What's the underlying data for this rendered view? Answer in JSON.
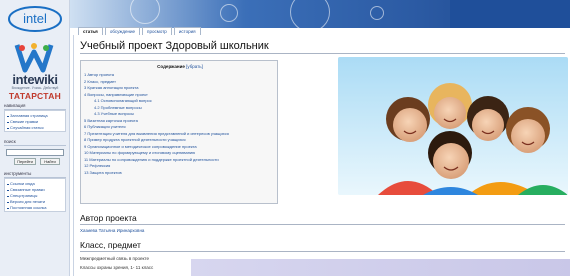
{
  "sidebar": {
    "logo_text": "intel",
    "brand": "intewiki",
    "tagline": "Вхождение. Учись. Действуй",
    "region": "ТАТАРСТАН",
    "navigation": {
      "heading": "навигация",
      "items": [
        "Заглавная страница",
        "Свежие правки",
        "Случайная статья"
      ]
    },
    "search": {
      "heading": "поиск",
      "go_label": "Перейти",
      "find_label": "Найти",
      "value": ""
    },
    "toolbox": {
      "heading": "инструменты",
      "items": [
        "Ссылки сюда",
        "Связанные правки",
        "Спецстраницы",
        "Версия для печати",
        "Постоянная ссылка"
      ]
    }
  },
  "tabs": [
    {
      "label": "статья",
      "active": true
    },
    {
      "label": "обсуждение",
      "active": false
    },
    {
      "label": "просмотр",
      "active": false
    },
    {
      "label": "история",
      "active": false
    }
  ],
  "page": {
    "title": "Учебный проект Здоровый школьник"
  },
  "toc": {
    "title": "Содержание",
    "toggle": "[убрать]",
    "items": [
      {
        "text": "1 Автор проекта",
        "level": 1
      },
      {
        "text": "2 Класс, предмет",
        "level": 1
      },
      {
        "text": "3 Краткая аннотация проекта",
        "level": 1
      },
      {
        "text": "4 Вопросы, направляющие проект",
        "level": 1
      },
      {
        "text": "4.1 Основополагающий вопрос",
        "level": 2
      },
      {
        "text": "4.2 Проблемные вопросы",
        "level": 2
      },
      {
        "text": "4.3 Учебные вопросы",
        "level": 2
      },
      {
        "text": "5 Визитная карточка проекта",
        "level": 1
      },
      {
        "text": "6 Публикация учителя",
        "level": 1
      },
      {
        "text": "7 Презентация учителя для выявления представлений и интересов учащихся",
        "level": 1
      },
      {
        "text": "8 Пример продукта проектной деятельности учащихся",
        "level": 1
      },
      {
        "text": "9 Организационное и методическое сопровождение проекта",
        "level": 1
      },
      {
        "text": "10 Материалы по формирующему и итоговому оцениванию",
        "level": 1
      },
      {
        "text": "11 Материалы по сопровождению и поддержке проектной деятельности",
        "level": 1
      },
      {
        "text": "12 Рефлексия",
        "level": 1
      },
      {
        "text": "13 Защита проектов",
        "level": 1
      }
    ]
  },
  "sections": {
    "author": {
      "heading": "Автор проекта",
      "name": "Хазиева Татьяна Иринарховна"
    },
    "class_subject": {
      "heading": "Класс, предмет",
      "line1": "Межпредметный связь в проекте",
      "line2": "Классы охраны зрения, 1- 11 класс"
    }
  },
  "colors": {
    "link": "#1d4f9a",
    "banner": "#2b5aa3",
    "region": "#c0392b",
    "sidebar_bg": "#e9eef6"
  }
}
